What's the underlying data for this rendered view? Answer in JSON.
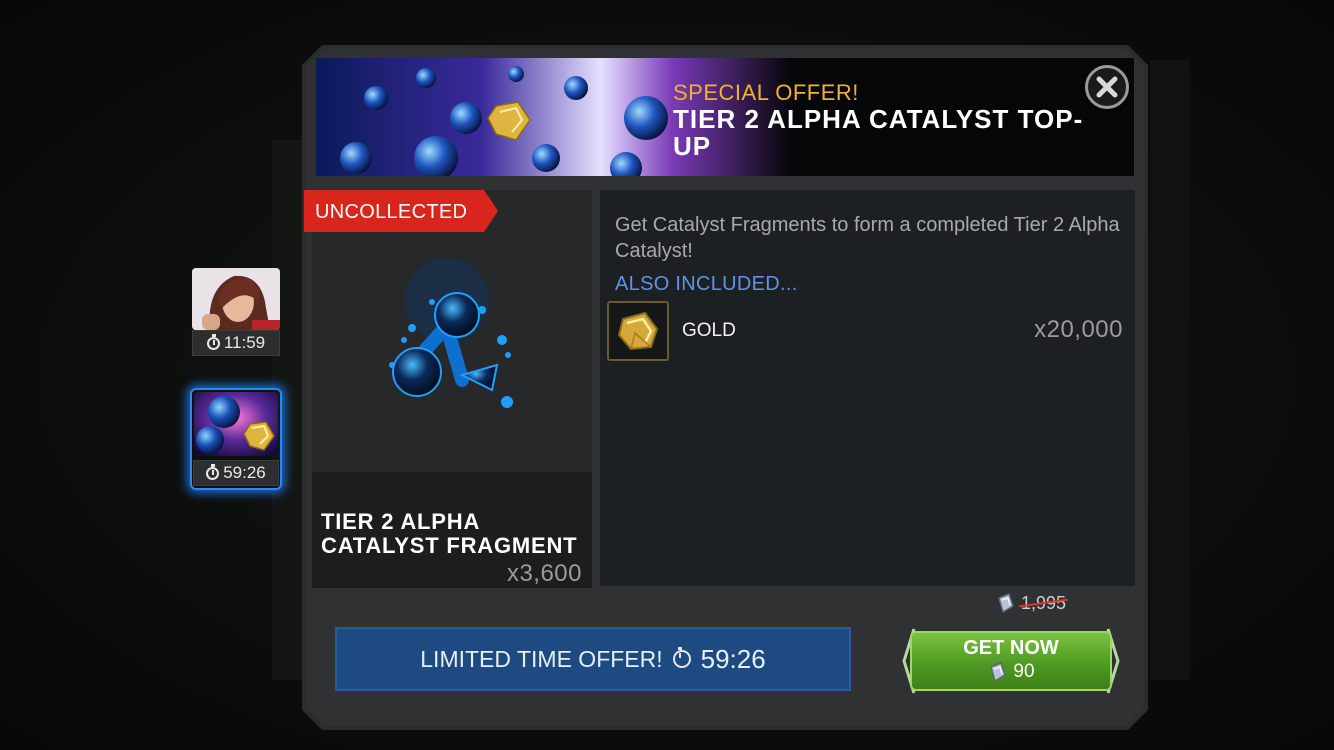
{
  "side_offers": [
    {
      "timer": "11:59"
    },
    {
      "timer": "59:26"
    }
  ],
  "banner": {
    "subtitle": "SPECIAL OFFER!",
    "title": "TIER 2 ALPHA CATALYST TOP-UP"
  },
  "item": {
    "badge": "UNCOLLECTED",
    "name": "TIER 2 ALPHA CATALYST FRAGMENT",
    "quantity": "x3,600"
  },
  "description": {
    "text": "Get Catalyst Fragments to form a completed Tier 2 Alpha Catalyst!",
    "also_included": "ALSO INCLUDED...",
    "extras": [
      {
        "label": "GOLD",
        "quantity": "x20,000"
      }
    ]
  },
  "footer": {
    "limited_label": "LIMITED TIME OFFER!",
    "timer": "59:26",
    "old_price": "1,995",
    "buy_label": "GET NOW",
    "price": "90"
  },
  "colors": {
    "accent_gold": "#f0b428",
    "badge_red": "#d8261c",
    "link_blue": "#5f93e6",
    "buy_green": "#5aa62a",
    "limited_blue": "#1d4a80"
  }
}
